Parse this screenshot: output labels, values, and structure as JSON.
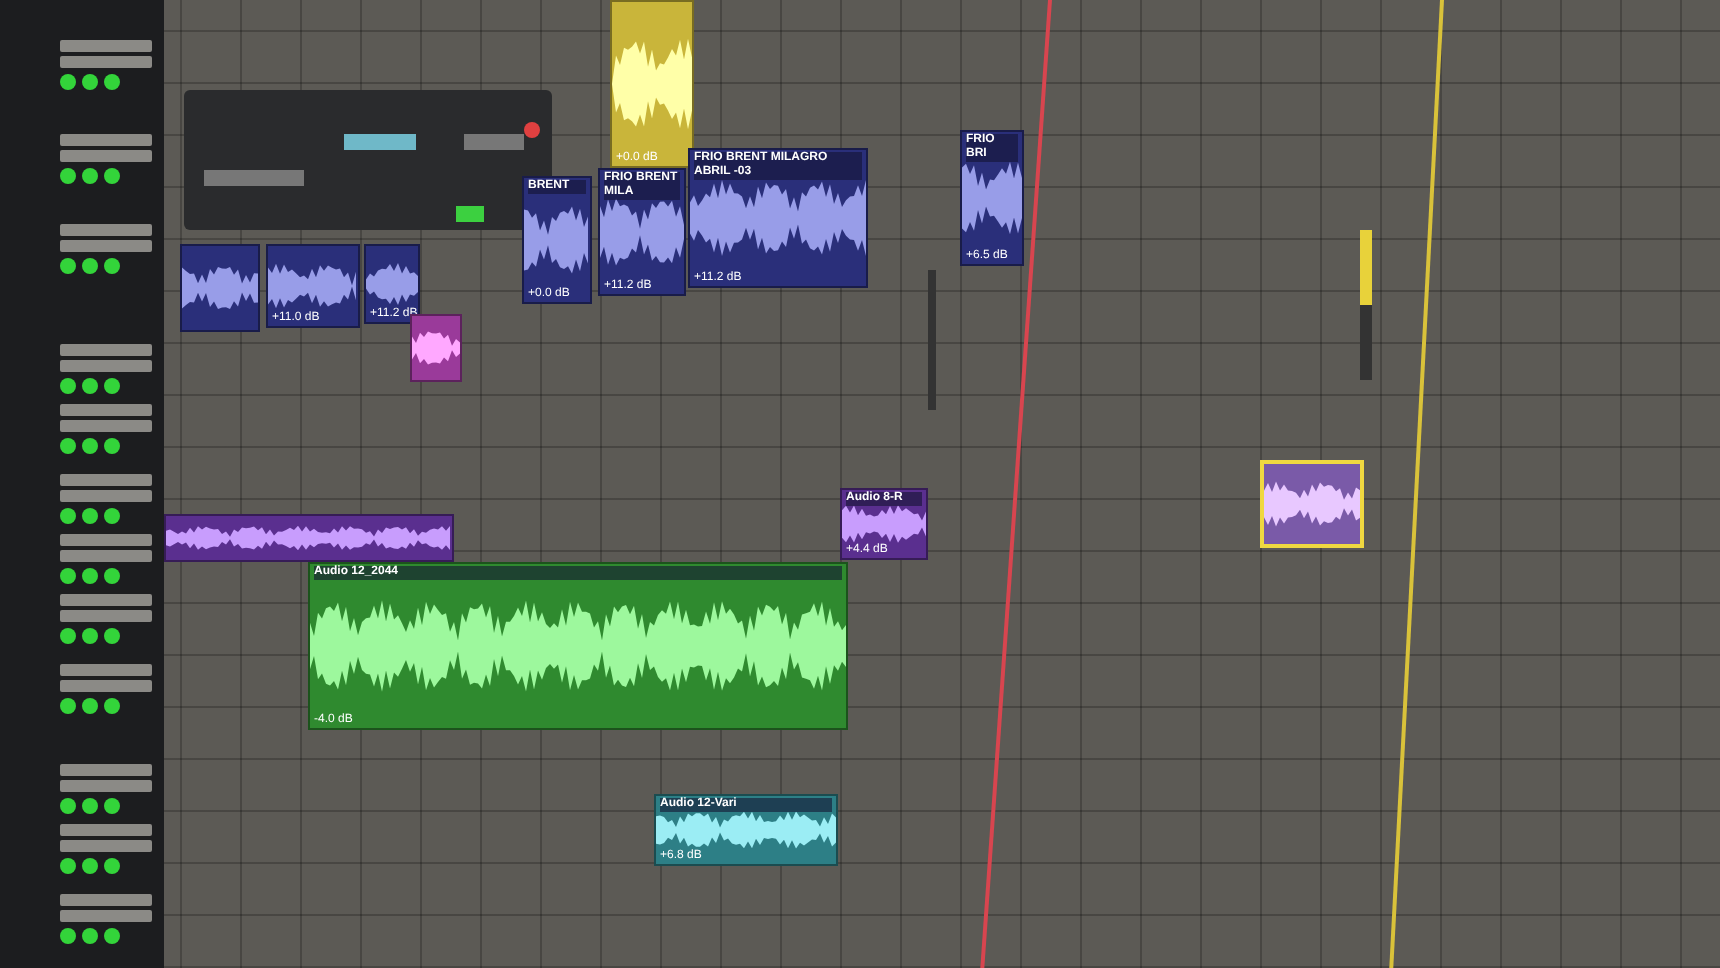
{
  "clips": [
    {
      "color": "#c9b53a",
      "gain": "+0.0 dB",
      "selected": false
    },
    {
      "color": "#2a2f7a",
      "selected": false
    },
    {
      "color": "#2a2f7a",
      "gain": "+11.0 dB",
      "selected": false
    },
    {
      "color": "#2a2f7a",
      "gain": "+11.2 dB",
      "selected": false
    },
    {
      "color": "#2a2f7a",
      "label": "BRENT",
      "gain": "+0.0 dB",
      "selected": false
    },
    {
      "color": "#2a2f7a",
      "label": "FRIO BRENT MILA",
      "gain": "+11.2 dB",
      "selected": false
    },
    {
      "color": "#2a2f7a",
      "label": "FRIO BRENT MILAGRO ABRIL -03",
      "gain": "+11.2 dB",
      "selected": false
    },
    {
      "color": "#2a2f7a",
      "label": "FRIO BRI",
      "gain": "+6.5 dB",
      "selected": false
    },
    {
      "color": "#9a3a9a",
      "selected": false
    },
    {
      "color": "#5a2f8f",
      "selected": false
    },
    {
      "color": "#5a2f8f",
      "label": "Audio 8-R",
      "gain": "+4.4 dB",
      "selected": false
    },
    {
      "color": "#2f8a2f",
      "label": "Audio 12_2044",
      "gain": "-4.0 dB",
      "selected": false
    },
    {
      "color": "#2d7f86",
      "label": "Audio 12-Vari",
      "gain": "+6.8 dB",
      "selected": false
    },
    {
      "color": "#7a5aa8",
      "selected": true
    }
  ]
}
